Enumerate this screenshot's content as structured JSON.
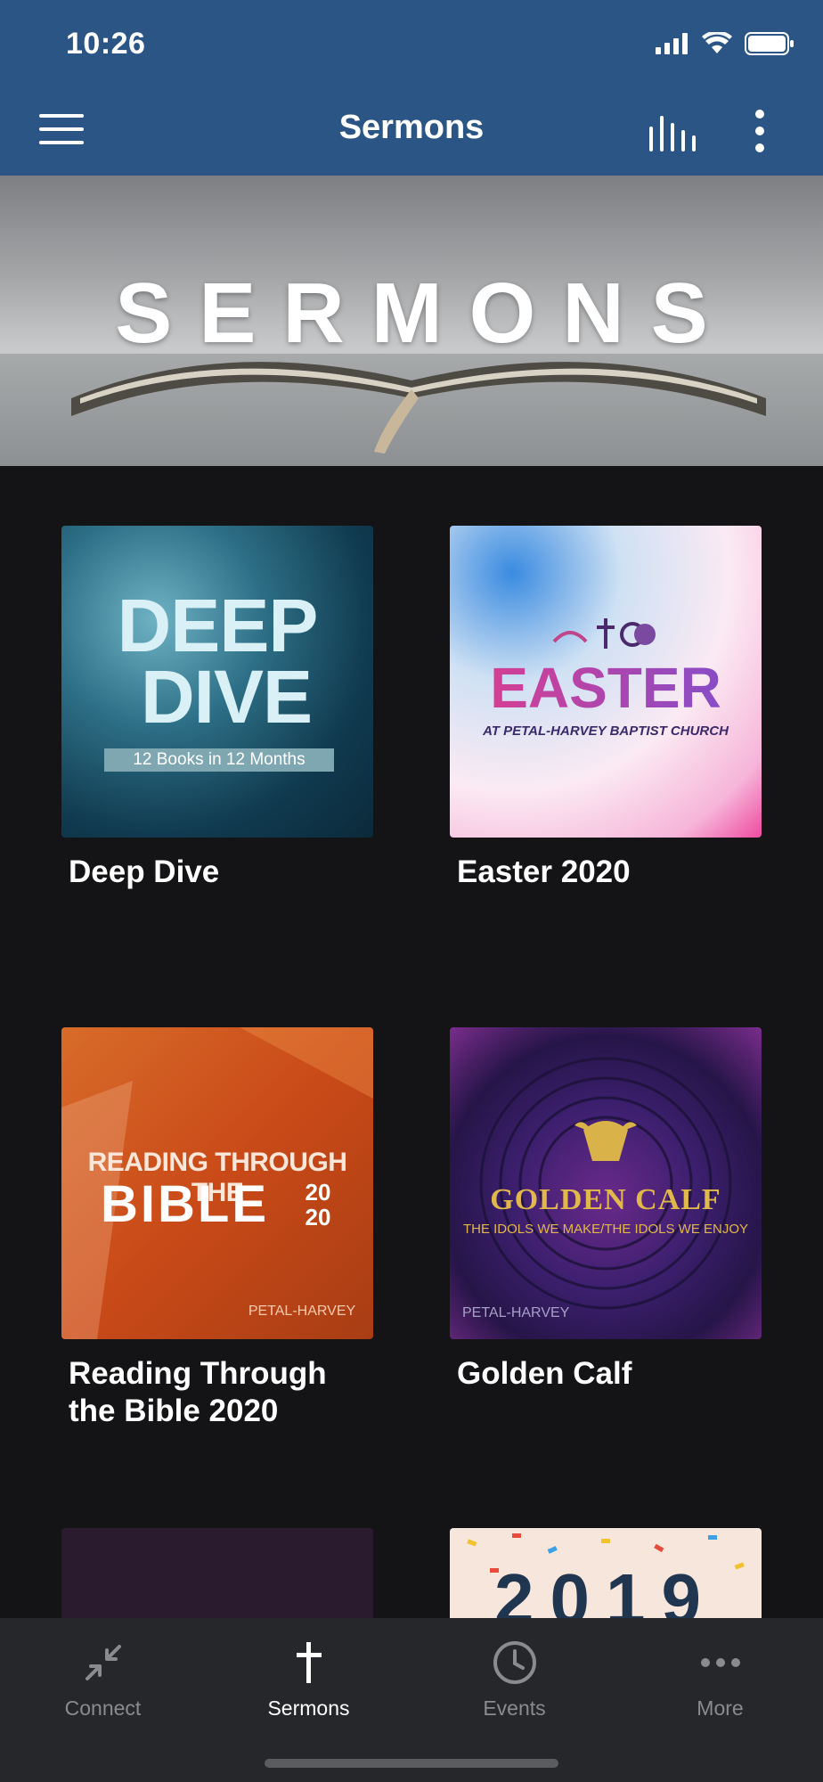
{
  "status_bar": {
    "time": "10:26"
  },
  "app_bar": {
    "title": "Sermons"
  },
  "banner": {
    "text": "SERMONS"
  },
  "series": [
    {
      "title": "Deep Dive",
      "art_line1": "DEEP",
      "art_line2": "DIVE",
      "art_caption": "12 Books in 12 Months"
    },
    {
      "title": "Easter 2020",
      "art_line1": "EASTER",
      "art_caption": "AT PETAL-HARVEY BAPTIST CHURCH"
    },
    {
      "title": "Reading Through the Bible 2020",
      "art_line1": "READING THROUGH THE",
      "art_line2": "BIBLE",
      "art_year_top": "20",
      "art_year_bottom": "20",
      "art_brand": "PETAL-HARVEY"
    },
    {
      "title": "Golden Calf",
      "art_line1": "GOLDEN CALF",
      "art_caption": "THE IDOLS WE MAKE/THE IDOLS WE ENJOY",
      "art_brand": "PETAL-HARVEY"
    },
    {
      "title": ""
    },
    {
      "title": "",
      "art_line1": "2019"
    }
  ],
  "tabs": [
    {
      "label": "Connect",
      "icon": "compress-arrows-icon"
    },
    {
      "label": "Sermons",
      "icon": "cross-icon"
    },
    {
      "label": "Events",
      "icon": "clock-icon"
    },
    {
      "label": "More",
      "icon": "more-dots-icon"
    }
  ],
  "colors": {
    "header": "#2b5585",
    "background": "#141416",
    "tabbar": "#26272a"
  }
}
